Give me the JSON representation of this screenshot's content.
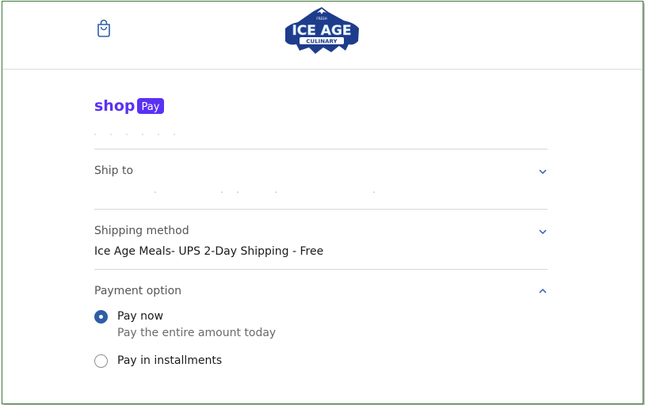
{
  "header": {
    "logo_text_top": "ICE AGE",
    "logo_text_bottom": "CULINARY",
    "logo_small": "FRESH"
  },
  "shop_pay": {
    "brand": "shop",
    "badge": "Pay"
  },
  "sections": {
    "ship_to": {
      "title": "Ship to"
    },
    "shipping_method": {
      "title": "Shipping method",
      "value": "Ice Age Meals- UPS 2-Day Shipping - Free"
    },
    "payment_option": {
      "title": "Payment option",
      "options": [
        {
          "label": "Pay now",
          "sublabel": "Pay the entire amount today",
          "selected": true
        },
        {
          "label": "Pay in installments",
          "selected": false
        }
      ]
    }
  },
  "colors": {
    "accent": "#2f5ea8",
    "shop_purple": "#5a31f4",
    "logo_navy": "#1e3c8c"
  }
}
